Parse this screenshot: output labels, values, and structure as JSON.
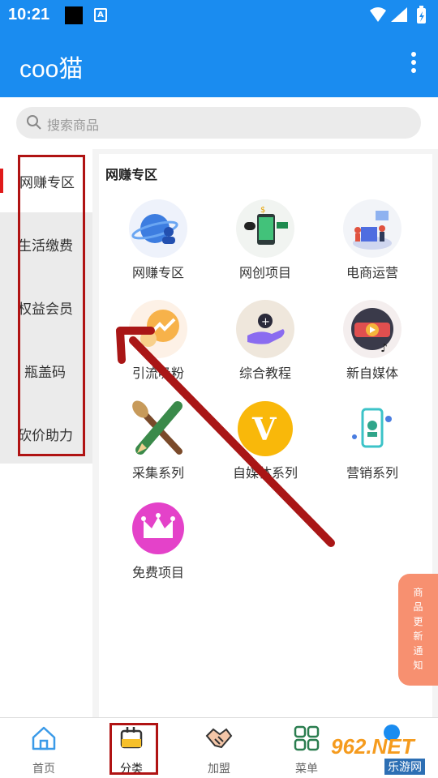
{
  "status": {
    "time": "10:21",
    "a_badge": "A"
  },
  "app": {
    "title": "coo猫"
  },
  "search": {
    "placeholder": "搜索商品"
  },
  "sidebar": {
    "items": [
      {
        "label": "网赚专区"
      },
      {
        "label": "生活缴费"
      },
      {
        "label": "权益会员"
      },
      {
        "label": "瓶盖码"
      },
      {
        "label": "砍价助力"
      }
    ]
  },
  "content": {
    "section_title": "网赚专区",
    "items": [
      {
        "label": "网赚专区",
        "icon": "planet-user-icon"
      },
      {
        "label": "网创项目",
        "icon": "money-phone-icon"
      },
      {
        "label": "电商运营",
        "icon": "ecommerce-team-icon"
      },
      {
        "label": "引流吸粉",
        "icon": "trend-chat-icon"
      },
      {
        "label": "综合教程",
        "icon": "hand-plus-icon"
      },
      {
        "label": "新自媒体",
        "icon": "video-disc-icon"
      },
      {
        "label": "采集系列",
        "icon": "brush-pencil-icon"
      },
      {
        "label": "自媒体系列",
        "icon": "v-badge-icon"
      },
      {
        "label": "营销系列",
        "icon": "marketing-phone-icon"
      },
      {
        "label": "免费项目",
        "icon": "crown-icon"
      }
    ]
  },
  "float_notice": {
    "chars": [
      "商",
      "品",
      "更",
      "新",
      "通",
      "知"
    ]
  },
  "bottom_nav": {
    "items": [
      {
        "label": "首页",
        "icon": "home-icon"
      },
      {
        "label": "分类",
        "icon": "category-icon"
      },
      {
        "label": "加盟",
        "icon": "handshake-icon"
      },
      {
        "label": "菜单",
        "icon": "grid-menu-icon"
      }
    ]
  },
  "watermark": {
    "main": "962.NET",
    "sub": "乐游网"
  },
  "colors": {
    "primary": "#1a8cf0",
    "annotation": "#b01313",
    "notice": "#f79070"
  }
}
